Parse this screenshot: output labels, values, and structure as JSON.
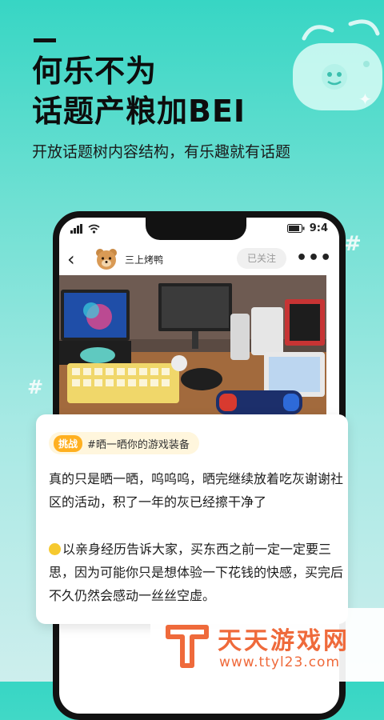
{
  "hero": {
    "title_line1": "何乐不为",
    "title_line2": "话题产粮加BEI",
    "subtitle": "开放话题树内容结构，有乐趣就有话题"
  },
  "phone": {
    "status": {
      "time": "9:4"
    },
    "post": {
      "author": "三上烤鸭",
      "follow_label": "已关注",
      "more_label": "•••",
      "back_label": "‹"
    }
  },
  "card": {
    "tag_badge": "挑战",
    "tag_topic": "#晒一晒你的游戏装备",
    "paragraph1": "真的只是晒一晒，呜呜呜，晒完继续放着吃灰谢谢社区的活动，积了一年的灰已经擦干净了",
    "paragraph2": "以亲身经历告诉大家，买东西之前一定一定要三思，因为可能你只是想体验一下花钱的快感，买完后不久仍然会感动一丝丝空虚。"
  },
  "watermark": {
    "name": "天天游戏网",
    "url": "www.ttyl23.com"
  },
  "colors": {
    "background_top": "#37d6c4",
    "background_bottom": "#cdeeed",
    "tag_badge": "#ffb020",
    "watermark": "#ef6a3b"
  },
  "icons": [
    "gamepad-icon",
    "hash-sparkle-icon",
    "back-icon",
    "bear-avatar-icon",
    "more-icon",
    "signal-icon",
    "wifi-icon",
    "battery-icon",
    "emoji-icon",
    "watermark-logo-icon"
  ]
}
